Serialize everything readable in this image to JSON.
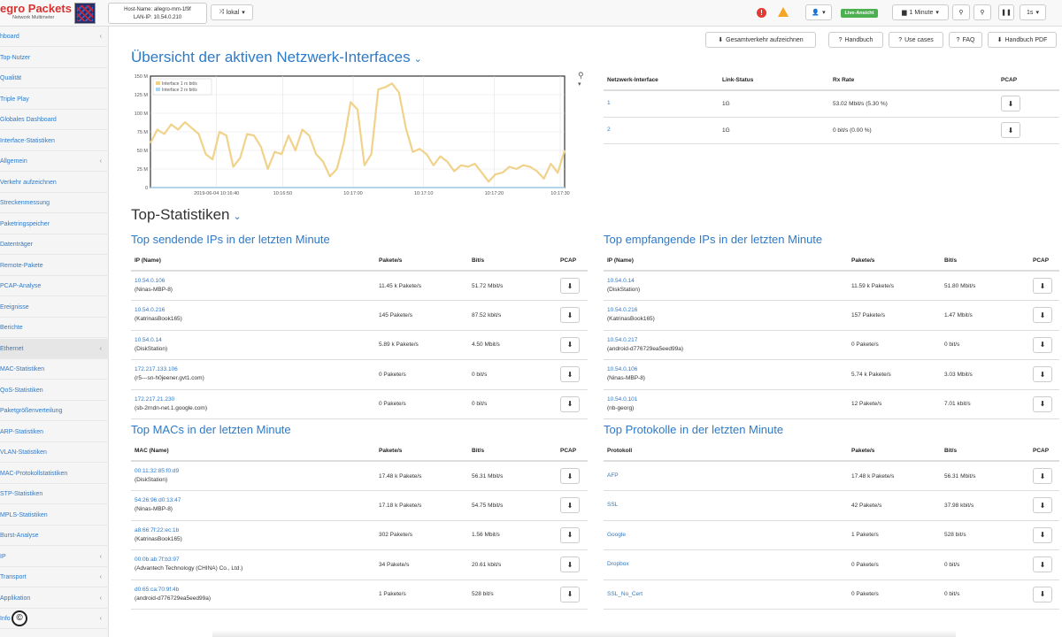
{
  "header": {
    "logo_title": "egro Packets",
    "logo_sub": "Network Multimeter",
    "host_name": "Host-Name: allegro-mm-1f9f",
    "lan_ip": "LAN-IP: 10.54.0.210",
    "location": "lokal",
    "live_label": "Live-Ansicht",
    "interval": "1 Minute",
    "speed": "1s",
    "status_colors": {
      "error": "#e53935",
      "warning": "#f5a623",
      "live": "#4caf50"
    }
  },
  "actions": {
    "export": "Gesamtverkehr aufzeichnen",
    "handbuch": "Handbuch",
    "use_cases": "Use cases",
    "faq": "FAQ",
    "handbuch_pdf": "Handbuch PDF"
  },
  "sidebar": {
    "items": [
      {
        "label": "hboard",
        "chev": "‹"
      },
      {
        "label": "Top-Nutzer",
        "chev": ""
      },
      {
        "label": "Qualität",
        "chev": ""
      },
      {
        "label": "Triple Play",
        "chev": ""
      },
      {
        "label": "Globales Dashboard",
        "chev": ""
      },
      {
        "label": "Interface-Statistiken",
        "chev": ""
      },
      {
        "label": "Allgemein",
        "chev": "‹"
      },
      {
        "label": "Verkehr aufzeichnen",
        "chev": ""
      },
      {
        "label": "Streckenmessung",
        "chev": ""
      },
      {
        "label": "Paketringspeicher",
        "chev": ""
      },
      {
        "label": "Datenträger",
        "chev": ""
      },
      {
        "label": "Remote-Pakete",
        "chev": ""
      },
      {
        "label": "PCAP-Analyse",
        "chev": ""
      },
      {
        "label": "Ereignisse",
        "chev": ""
      },
      {
        "label": "Berichte",
        "chev": ""
      },
      {
        "label": "Ethernet",
        "chev": "‹"
      },
      {
        "label": "MAC-Statistiken",
        "chev": ""
      },
      {
        "label": "QoS-Statistiken",
        "chev": ""
      },
      {
        "label": "Paketgrößenverteilung",
        "chev": ""
      },
      {
        "label": "ARP-Statistiken",
        "chev": ""
      },
      {
        "label": "VLAN-Statistiken",
        "chev": ""
      },
      {
        "label": "MAC-Protokollstatistiken",
        "chev": ""
      },
      {
        "label": "STP-Statistiken",
        "chev": ""
      },
      {
        "label": "MPLS-Statistiken",
        "chev": ""
      },
      {
        "label": "Burst-Analyse",
        "chev": ""
      },
      {
        "label": "IP",
        "chev": "‹"
      },
      {
        "label": "Transport",
        "chev": "‹"
      },
      {
        "label": "Applikation",
        "chev": "‹"
      },
      {
        "label": "Info",
        "chev": "‹"
      }
    ]
  },
  "overview": {
    "title": "Übersicht der aktiven Netzwerk-Interfaces",
    "columns": [
      "Netzwerk-Interface",
      "Link-Status",
      "Rx Rate",
      "PCAP"
    ],
    "rows": [
      {
        "iface": "1",
        "link": "1G",
        "rate": "53.02 Mbit/s (5.30 %)"
      },
      {
        "iface": "2",
        "link": "1G",
        "rate": "0 bit/s (0.00 %)"
      }
    ]
  },
  "chart_data": {
    "type": "line",
    "title": "",
    "legend": [
      "Interface 1 rx bit/s",
      "Interface 2 rx bit/s"
    ],
    "legend_position": "top-left",
    "ylim": [
      0,
      150
    ],
    "y_ticks": [
      "0",
      "25 M",
      "50 M",
      "75 M",
      "100 M",
      "125 M",
      "150 M"
    ],
    "x_ticks": [
      "2019-06-04 10:16:40",
      "10:16:50",
      "10:17:00",
      "10:17:10",
      "10:17:20",
      "10:17:30"
    ],
    "grid": true,
    "colors": [
      "#f0d28a",
      "#a8d4f0"
    ],
    "series": [
      {
        "name": "Interface 1 rx bit/s",
        "values": [
          60,
          78,
          72,
          85,
          78,
          88,
          80,
          72,
          45,
          38,
          75,
          70,
          28,
          40,
          72,
          70,
          55,
          25,
          48,
          45,
          70,
          50,
          78,
          70,
          45,
          35,
          15,
          25,
          60,
          115,
          105,
          30,
          45,
          132,
          135,
          140,
          128,
          80,
          48,
          52,
          45,
          30,
          42,
          35,
          22,
          30,
          28,
          32,
          20,
          8,
          18,
          20,
          28,
          25,
          30,
          28,
          22,
          12,
          32,
          20,
          50
        ]
      },
      {
        "name": "Interface 2 rx bit/s",
        "values": [
          0,
          0,
          0,
          0,
          0,
          0,
          0,
          0,
          0,
          0,
          0,
          0,
          0,
          0,
          0,
          0,
          0,
          0,
          0,
          0,
          0,
          0,
          0,
          0,
          0,
          0,
          0,
          0,
          0,
          0,
          0,
          0,
          0,
          0,
          0,
          0,
          0,
          0,
          0,
          0,
          0,
          0,
          0,
          0,
          0,
          0,
          0,
          0,
          0,
          0,
          0,
          0,
          0,
          0,
          0,
          0,
          0,
          0,
          0,
          0,
          0
        ]
      }
    ]
  },
  "top_stats": {
    "title": "Top-Statistiken"
  },
  "send_ips": {
    "title": "Top sendende IPs in der letzten Minute",
    "columns": [
      "IP (Name)",
      "Pakete/s",
      "Bit/s",
      "PCAP"
    ],
    "rows": [
      {
        "ip": "10.54.0.106",
        "name": "(Ninas-MBP-8)",
        "pkts": "11.45 k Pakete/s",
        "bits": "51.72 Mbit/s"
      },
      {
        "ip": "10.54.0.216",
        "name": "(KatrinasBook165)",
        "pkts": "145 Pakete/s",
        "bits": "87.52 kbit/s"
      },
      {
        "ip": "10.54.0.14",
        "name": "(DiskStation)",
        "pkts": "5.89 k Pakete/s",
        "bits": "4.50 Mbit/s"
      },
      {
        "ip": "172.217.133.106",
        "name": "(r5---sn-h0jeener.gvt1.com)",
        "pkts": "0 Pakete/s",
        "bits": "0 bit/s"
      },
      {
        "ip": "172.217.21.230",
        "name": "(sb-2rndn-net.1.google.com)",
        "pkts": "0 Pakete/s",
        "bits": "0 bit/s"
      }
    ]
  },
  "recv_ips": {
    "title": "Top empfangende IPs in der letzten Minute",
    "columns": [
      "IP (Name)",
      "Pakete/s",
      "Bit/s",
      "PCAP"
    ],
    "rows": [
      {
        "ip": "10.54.0.14",
        "name": "(DiskStation)",
        "pkts": "11.59 k Pakete/s",
        "bits": "51.80 Mbit/s"
      },
      {
        "ip": "10.54.0.216",
        "name": "(KatrinasBook165)",
        "pkts": "157 Pakete/s",
        "bits": "1.47 Mbit/s"
      },
      {
        "ip": "10.54.0.217",
        "name": "(android-d776729ea5eed99a)",
        "pkts": "0 Pakete/s",
        "bits": "0 bit/s"
      },
      {
        "ip": "10.54.0.106",
        "name": "(Ninas-MBP-8)",
        "pkts": "5.74 k Pakete/s",
        "bits": "3.03 Mbit/s"
      },
      {
        "ip": "10.54.0.101",
        "name": "(nb-georg)",
        "pkts": "12 Pakete/s",
        "bits": "7.01 kbit/s"
      }
    ]
  },
  "macs": {
    "title": "Top MACs in der letzten Minute",
    "columns": [
      "MAC (Name)",
      "Pakete/s",
      "Bit/s",
      "PCAP"
    ],
    "rows": [
      {
        "mac": "00:11:32:85:f0:d9",
        "name": "(DiskStation)",
        "pkts": "17.48 k Pakete/s",
        "bits": "56.31 Mbit/s"
      },
      {
        "mac": "54:26:96:d0:13:47",
        "name": "(Ninas-MBP-8)",
        "pkts": "17.18 k Pakete/s",
        "bits": "54.75 Mbit/s"
      },
      {
        "mac": "a8:66:7f:22:ec:1b",
        "name": "(KatrinasBook165)",
        "pkts": "302 Pakete/s",
        "bits": "1.56 Mbit/s"
      },
      {
        "mac": "00:0b:ab:7f:b3:97",
        "name": "(Advantech Technology (CHINA) Co., Ltd.)",
        "pkts": "34 Pakete/s",
        "bits": "20.61 kbit/s"
      },
      {
        "mac": "d0:65:ca:70:9f:4b",
        "name": "(android-d776729ea5eed99a)",
        "pkts": "1 Pakete/s",
        "bits": "528 bit/s"
      }
    ]
  },
  "protocols": {
    "title": "Top Protokolle in der letzten Minute",
    "columns": [
      "Protokoll",
      "Pakete/s",
      "Bit/s",
      "PCAP"
    ],
    "rows": [
      {
        "proto": "AFP",
        "pkts": "17.48 k Pakete/s",
        "bits": "56.31 Mbit/s"
      },
      {
        "proto": "SSL",
        "pkts": "42 Pakete/s",
        "bits": "37.98 kbit/s"
      },
      {
        "proto": "Google",
        "pkts": "1 Pakete/s",
        "bits": "528 bit/s"
      },
      {
        "proto": "Dropbox",
        "pkts": "0 Pakete/s",
        "bits": "0 bit/s"
      },
      {
        "proto": "SSL_No_Cert",
        "pkts": "0 Pakete/s",
        "bits": "0 bit/s"
      }
    ]
  }
}
